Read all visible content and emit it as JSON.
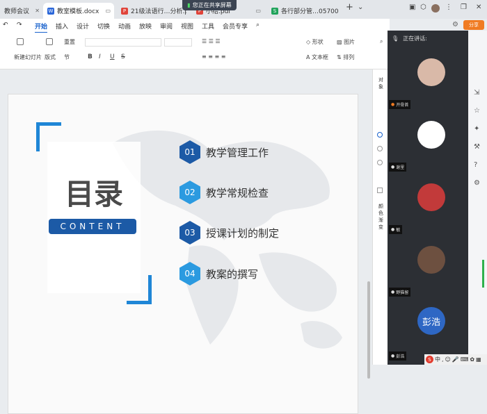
{
  "browser_tabs": [
    {
      "label": "教师会议",
      "icon": "",
      "icon_color": "#e23b2e"
    },
    {
      "label": "教室模板.docx",
      "icon": "W",
      "icon_color": "#2b67d9"
    },
    {
      "label": "21级法语行…分析.pdf",
      "icon": "P",
      "icon_color": "#e0443a"
    },
    {
      "label": "小结.pdf",
      "icon": "P",
      "icon_color": "#e0443a"
    },
    {
      "label": "各行部分管…05700",
      "icon": "S",
      "icon_color": "#20a35b"
    }
  ],
  "share_banner": "您正在共享屏幕",
  "add_tab": "+",
  "top_right_button": "分享",
  "menu": [
    "开始",
    "插入",
    "设计",
    "切换",
    "动画",
    "放映",
    "审阅",
    "视图",
    "工具",
    "会员专享"
  ],
  "menu_active_index": 0,
  "ribbon": {
    "new_slide": "新建幻灯片",
    "layout": "版式",
    "section": "节",
    "reset": "重置",
    "shape": "形状",
    "picture": "图片",
    "textbox": "文本框",
    "arrange": "排列",
    "bold": "B",
    "italic": "I",
    "underline": "U",
    "strike": "S"
  },
  "slide": {
    "title": "目录",
    "subtitle": "CONTENT",
    "accent": "#1f86d6",
    "items": [
      {
        "num": "01",
        "text": "教学管理工作",
        "color": "#1c5aa6"
      },
      {
        "num": "02",
        "text": "教学常规检查",
        "color": "#2b9ae0"
      },
      {
        "num": "03",
        "text": "授课计划的制定",
        "color": "#1c5aa6"
      },
      {
        "num": "04",
        "text": "教案的撰写",
        "color": "#2b9ae0"
      }
    ]
  },
  "right_pane": {
    "label1": "对象",
    "label2": "颜色",
    "label3": "渐变"
  },
  "meeting": {
    "speaking_label": "正在讲话:",
    "participants": [
      {
        "name": "开骨首",
        "avatar_bg": "#d9b9a8",
        "initials": ""
      },
      {
        "name": "谢里",
        "avatar_bg": "#ffffff",
        "initials": ""
      },
      {
        "name": "敏",
        "avatar_bg": "#c23a3a",
        "initials": ""
      },
      {
        "name": "野猫留",
        "avatar_bg": "#6d5040",
        "initials": ""
      },
      {
        "name": "彭浩",
        "avatar_bg": "#2e67c4",
        "initials": "彭浩"
      }
    ]
  },
  "tray": "中"
}
